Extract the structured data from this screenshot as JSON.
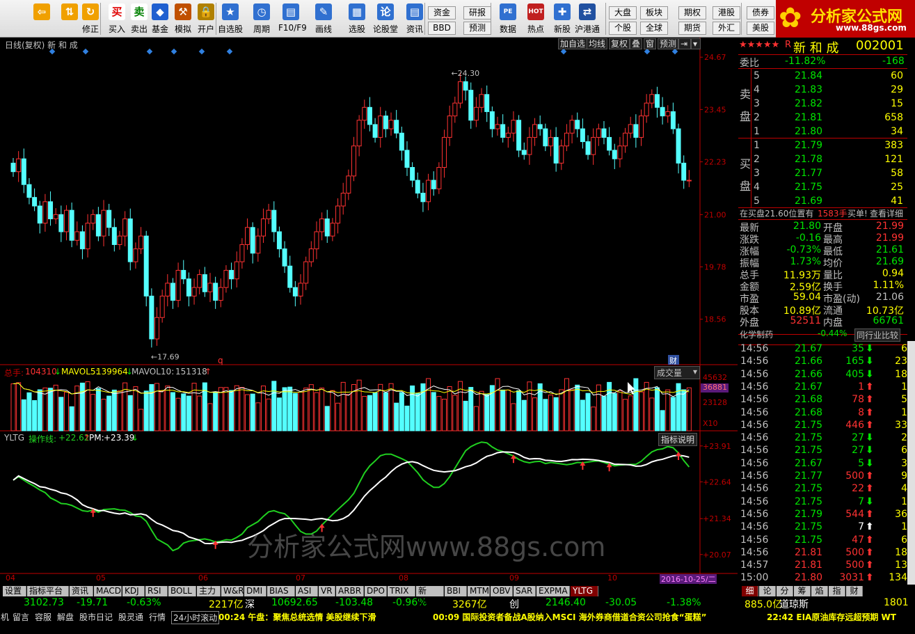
{
  "toolbar": {
    "buttons": [
      {
        "label": "",
        "icon": "back-arrow-icon"
      },
      {
        "label": "",
        "icon": "up-down-icon"
      },
      {
        "label": "修正",
        "icon": "refresh-icon"
      },
      {
        "label": "买入",
        "icon": "buy-icon",
        "glyph": "买"
      },
      {
        "label": "卖出",
        "icon": "sell-icon",
        "glyph": "卖"
      },
      {
        "label": "基金",
        "icon": "fund-icon"
      },
      {
        "label": "模拟",
        "icon": "hammer-icon"
      },
      {
        "label": "开户",
        "icon": "lock-icon"
      },
      {
        "label": "自选股",
        "icon": "star-list-icon"
      },
      {
        "label": "周期",
        "icon": "clock-icon"
      },
      {
        "label": "F10/F9",
        "icon": "f10-icon"
      },
      {
        "label": "画线",
        "icon": "pen-icon"
      },
      {
        "label": "选股",
        "icon": "select-stock-icon"
      },
      {
        "label": "论股堂",
        "icon": "forum-icon",
        "glyph": "论"
      },
      {
        "label": "资讯",
        "icon": "news-icon"
      },
      {
        "label": "数据",
        "icon": "pe-icon",
        "glyph": "PE"
      },
      {
        "label": "热点",
        "icon": "hot-icon",
        "glyph": "HOT"
      },
      {
        "label": "新股",
        "icon": "new-stock-icon"
      },
      {
        "label": "沪港通",
        "icon": "sse-hkex-icon"
      }
    ],
    "small_buttons": [
      "资金",
      "BBD",
      "研报",
      "预测",
      "大盘",
      "个股",
      "板块",
      "全球",
      "期权",
      "期货",
      "港股",
      "外汇",
      "债券",
      "美股"
    ]
  },
  "logo": {
    "title": "分析家公式网",
    "url": "www.88gs.com"
  },
  "chart": {
    "title": "日线(复权) 新 和 成",
    "top_buttons": [
      "加自选",
      "均线",
      "复权",
      "叠",
      "窗",
      "预测"
    ],
    "price_axis": [
      "24.67",
      "23.45",
      "22.23",
      "21.00",
      "19.78",
      "18.56"
    ],
    "high_label": "24.30",
    "low_label": "17.69",
    "marker_q": "q",
    "marker_cai": "财",
    "vol_header": {
      "prefix": "总手:",
      "value": "104310",
      "ma5_label": "MAVOL5:",
      "ma5": "139964",
      "ma10_label": "MAVOL10:",
      "ma10": "151318"
    },
    "vol_dropdown": "成交量",
    "vol_axis": [
      "45632",
      "36881",
      "23128",
      "X10"
    ],
    "ind_header": {
      "name": "YLTG",
      "op_label": "操作线:",
      "op": "+22.62",
      "pm_label": "PM:",
      "pm": "+23.39"
    },
    "ind_button": "指标说明",
    "ind_axis": [
      "+23.91",
      "+22.64",
      "+21.34",
      "+20.07"
    ],
    "months": [
      "04",
      "05",
      "06",
      "07",
      "08",
      "09",
      "10"
    ],
    "date_label": "2016-10-25/二",
    "watermark": "分析家公式网www.88gs.com"
  },
  "chart_data": {
    "type": "candlestick",
    "title": "日线(复权) 新 和 成",
    "ylim": [
      17.5,
      24.9
    ],
    "notes": "approximate daily OHLC, Apr–Oct 2016",
    "closes": [
      22.0,
      22.3,
      21.7,
      21.4,
      21.2,
      20.8,
      21.3,
      20.9,
      21.0,
      20.6,
      21.1,
      20.4,
      20.6,
      20.2,
      20.8,
      21.0,
      20.5,
      21.1,
      20.7,
      20.3,
      20.5,
      20.9,
      19.9,
      20.2,
      20.5,
      19.1,
      18.1,
      18.6,
      19.1,
      19.4,
      19.0,
      19.7,
      19.5,
      19.1,
      19.3,
      19.6,
      19.2,
      19.4,
      19.0,
      19.3,
      19.7,
      19.5,
      19.9,
      20.3,
      20.7,
      20.1,
      20.5,
      20.9,
      21.1,
      20.6,
      20.2,
      19.8,
      19.3,
      19.1,
      19.4,
      19.9,
      20.2,
      20.6,
      20.9,
      20.5,
      20.8,
      21.2,
      21.5,
      21.9,
      22.6,
      23.2,
      23.5,
      23.1,
      22.8,
      23.3,
      23.0,
      23.2,
      22.9,
      22.5,
      22.1,
      21.8,
      21.5,
      21.3,
      21.8,
      21.6,
      22.1,
      22.8,
      23.3,
      23.6,
      24.1,
      23.9,
      23.2,
      23.5,
      23.8,
      23.4,
      23.0,
      23.1,
      22.8,
      22.9,
      23.2,
      22.5,
      22.4,
      22.8,
      23.1,
      23.0,
      22.6,
      22.8,
      22.2,
      22.6,
      22.9,
      23.2,
      23.0,
      22.7,
      22.4,
      22.8,
      23.0,
      22.8,
      22.5,
      22.3,
      22.6,
      22.9,
      23.1,
      22.8,
      23.3,
      23.6,
      23.8,
      23.5,
      23.3,
      23.4,
      23.0,
      22.2,
      21.8,
      21.8
    ],
    "series": [
      {
        "name": "操作线",
        "last": 22.62
      },
      {
        "name": "PM",
        "last": 23.39
      }
    ],
    "volume_ylim": [
      0,
      45632
    ]
  },
  "quote": {
    "stars": "★★★★★",
    "R": "R",
    "name": "新 和 成",
    "code": "002001",
    "weibi_label": "委比",
    "weibi": "-11.82%",
    "weicha": "-168",
    "sell_label": [
      "卖",
      "盘"
    ],
    "buy_label": [
      "买",
      "盘"
    ],
    "asks": [
      [
        "5",
        "21.84",
        "60"
      ],
      [
        "4",
        "21.83",
        "29"
      ],
      [
        "3",
        "21.82",
        "15"
      ],
      [
        "2",
        "21.81",
        "658"
      ],
      [
        "1",
        "21.80",
        "34"
      ]
    ],
    "bids": [
      [
        "1",
        "21.79",
        "383"
      ],
      [
        "2",
        "21.78",
        "121"
      ],
      [
        "3",
        "21.77",
        "58"
      ],
      [
        "4",
        "21.75",
        "25"
      ],
      [
        "5",
        "21.69",
        "41"
      ]
    ],
    "notice": {
      "a": "在买盘21.60位置有",
      "b": "1583手",
      "c": "买单!",
      "d": "查看详细"
    },
    "stats": [
      [
        "最新",
        "21.80",
        "开盘",
        "21.99"
      ],
      [
        "涨跌",
        "-0.16",
        "最高",
        "21.99"
      ],
      [
        "涨幅",
        "-0.73%",
        "最低",
        "21.61"
      ],
      [
        "振幅",
        "1.73%",
        "均价",
        "21.69"
      ],
      [
        "总手",
        "11.93万",
        "量比",
        "0.94"
      ],
      [
        "金额",
        "2.59亿",
        "换手",
        "1.11%"
      ],
      [
        "市盈",
        "59.04",
        "市盈(动)",
        "21.06"
      ],
      [
        "股本",
        "10.89亿",
        "流通",
        "10.73亿"
      ],
      [
        "外盘",
        "52511",
        "内盘",
        "66761"
      ]
    ],
    "industry": {
      "name": "化学制药",
      "pct": "-0.44%",
      "btn": "同行业比较"
    },
    "ticks": [
      [
        "14:56",
        "21.67",
        "35",
        "dn",
        "6"
      ],
      [
        "14:56",
        "21.66",
        "165",
        "dn",
        "23"
      ],
      [
        "14:56",
        "21.66",
        "405",
        "dn",
        "18"
      ],
      [
        "14:56",
        "21.67",
        "1",
        "up",
        "1"
      ],
      [
        "14:56",
        "21.68",
        "78",
        "up",
        "5"
      ],
      [
        "14:56",
        "21.68",
        "8",
        "up",
        "1"
      ],
      [
        "14:56",
        "21.75",
        "446",
        "up",
        "33"
      ],
      [
        "14:56",
        "21.75",
        "27",
        "dn",
        "2"
      ],
      [
        "14:56",
        "21.75",
        "27",
        "dn",
        "6"
      ],
      [
        "14:56",
        "21.67",
        "5",
        "dn",
        "3"
      ],
      [
        "14:56",
        "21.77",
        "500",
        "up",
        "9"
      ],
      [
        "14:56",
        "21.75",
        "22",
        "up",
        "4"
      ],
      [
        "14:56",
        "21.75",
        "7",
        "dn",
        "1"
      ],
      [
        "14:56",
        "21.79",
        "544",
        "up",
        "36"
      ],
      [
        "14:56",
        "21.75",
        "7",
        "wh",
        "1"
      ],
      [
        "14:56",
        "21.75",
        "47",
        "up",
        "6"
      ],
      [
        "14:56",
        "21.81",
        "500",
        "up",
        "18"
      ],
      [
        "14:57",
        "21.81",
        "500",
        "up",
        "13"
      ],
      [
        "15:00",
        "21.80",
        "3031",
        "up",
        "134"
      ]
    ],
    "tabs": [
      "细",
      "论",
      "分",
      "筹",
      "焰",
      "指",
      "财"
    ]
  },
  "tabs": [
    "设置",
    "指标平台",
    "资讯",
    "MACD",
    "KDJ",
    "RSI",
    "BOLL",
    "主力",
    "W&R",
    "DMI",
    "BIAS",
    "ASI",
    "VR",
    "ARBR",
    "DPO",
    "TRIX",
    "新DMA",
    "BBI",
    "MTM",
    "OBV",
    "SAR",
    "EXPMA",
    "YLTG"
  ],
  "status": [
    {
      "t": "3102.73",
      "c": "dn"
    },
    {
      "t": "-19.71",
      "c": "dn"
    },
    {
      "t": "-0.63%",
      "c": "dn"
    },
    {
      "t": "2217亿",
      "c": "yl"
    },
    {
      "t": "深",
      "c": "wh"
    },
    {
      "t": "10692.65",
      "c": "dn"
    },
    {
      "t": "-103.48",
      "c": "dn"
    },
    {
      "t": "-0.96%",
      "c": "dn"
    },
    {
      "t": "3267亿",
      "c": "yl"
    },
    {
      "t": "创",
      "c": "wh"
    },
    {
      "t": "2146.40",
      "c": "dn"
    },
    {
      "t": "-30.05",
      "c": "dn"
    },
    {
      "t": "-1.38%",
      "c": "dn"
    },
    {
      "t": "885.0亿",
      "c": "yl"
    },
    {
      "t": "道琼斯",
      "c": "wh"
    },
    {
      "t": "1801",
      "c": "yl"
    }
  ],
  "bottom": {
    "items": [
      "机",
      "留言",
      "容服",
      "解盘",
      "股市日记",
      "股灵通",
      "行情",
      "24小时滚动"
    ],
    "news": [
      "00:24 午盘：聚焦总统选情 美股继续下滑",
      "00:09 国际投资者备战A股纳入MSCI 海外券商借道合资公司抢食“蛋糕”",
      "22:42 EIA原油库存远超预期 WT"
    ]
  }
}
